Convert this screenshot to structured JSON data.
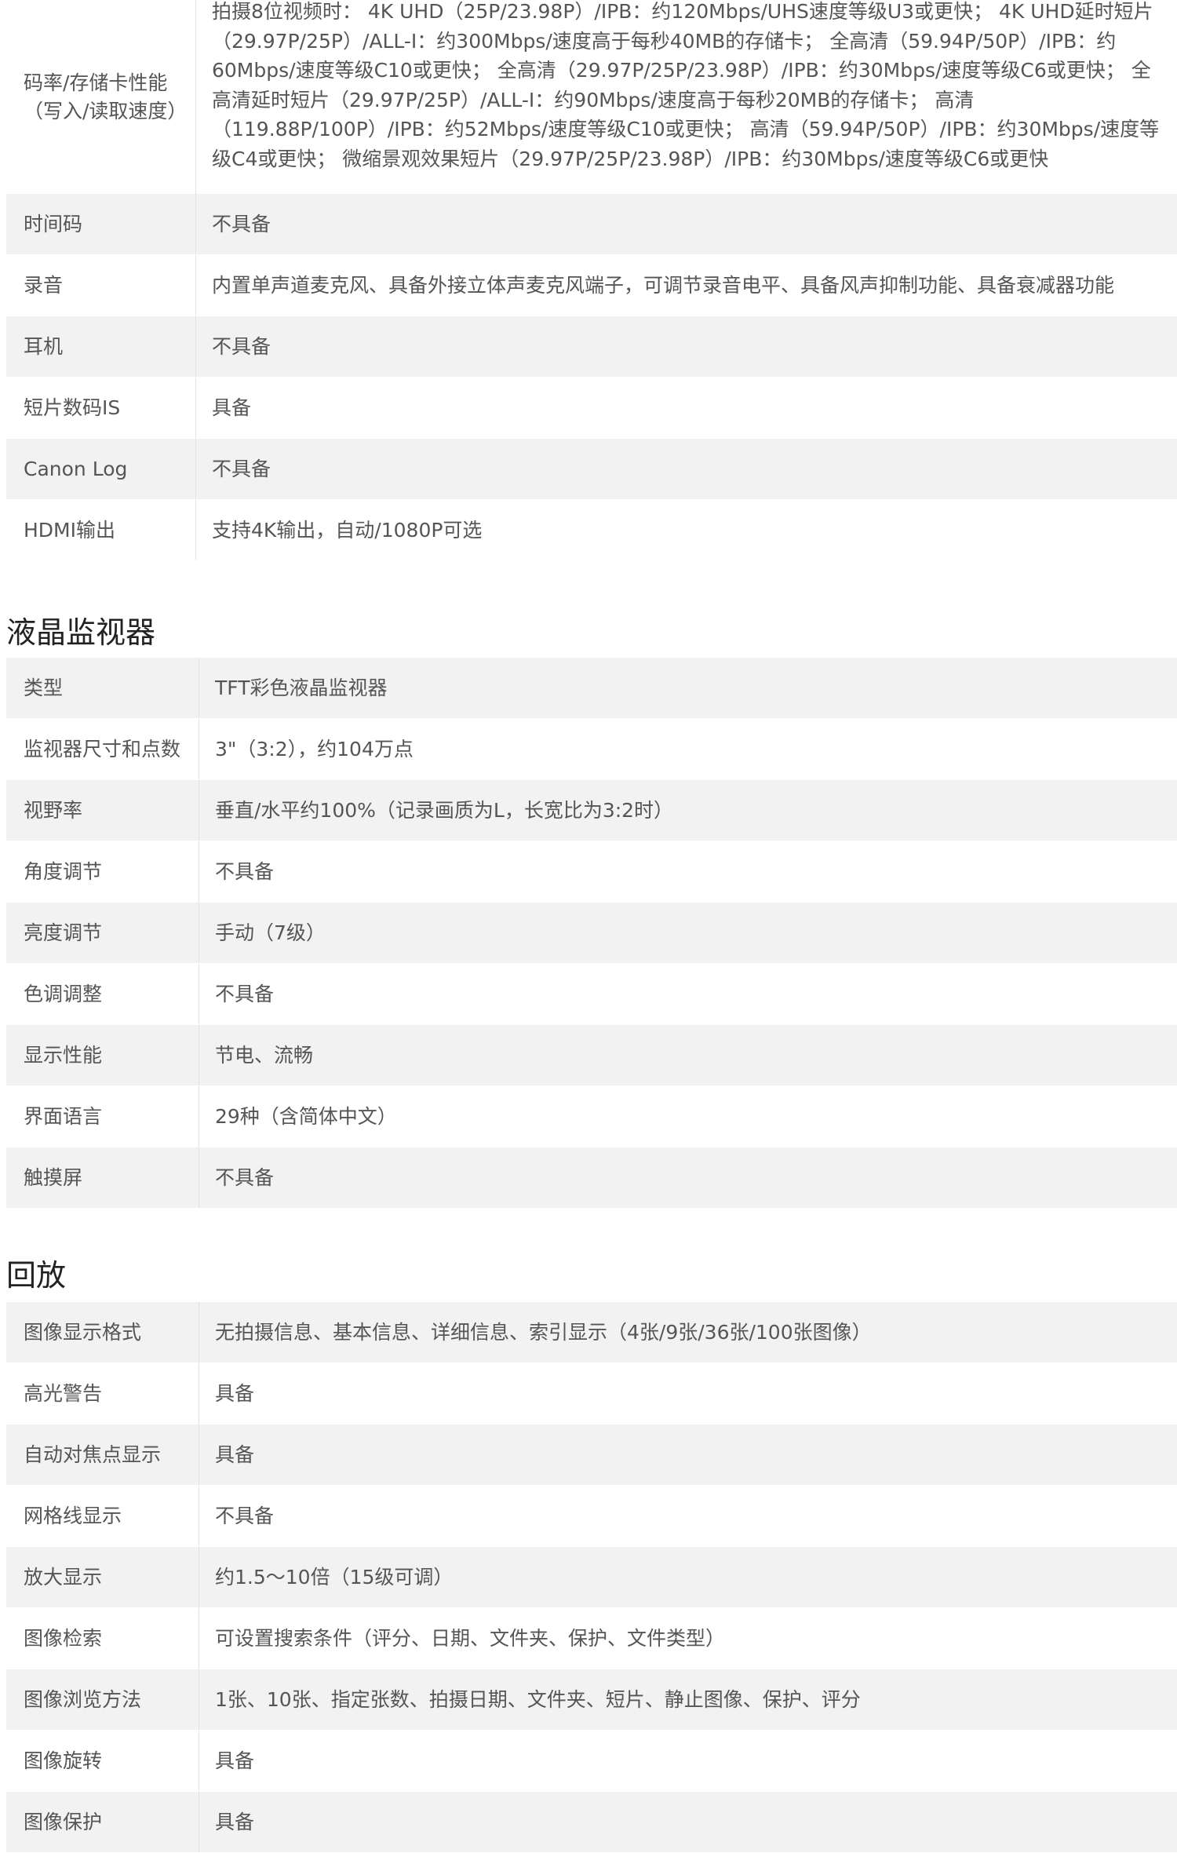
{
  "recording": {
    "rows": [
      {
        "label": "码率/存储卡性能（写入/读取速度）",
        "value": "拍摄8位视频时： 4K UHD（25P/23.98P）/IPB：约120Mbps/UHS速度等级U3或更快； 4K UHD延时短片（29.97P/25P）/ALL-I：约300Mbps/速度高于每秒40MB的存储卡； 全高清（59.94P/50P）/IPB：约60Mbps/速度等级C10或更快； 全高清（29.97P/25P/23.98P）/IPB：约30Mbps/速度等级C6或更快； 全高清延时短片（29.97P/25P）/ALL-I：约90Mbps/速度高于每秒20MB的存储卡； 高清（119.88P/100P）/IPB：约52Mbps/速度等级C10或更快； 高清（59.94P/50P）/IPB：约30Mbps/速度等级C4或更快； 微缩景观效果短片（29.97P/25P/23.98P）/IPB：约30Mbps/速度等级C6或更快"
      },
      {
        "label": "时间码",
        "value": "不具备"
      },
      {
        "label": "录音",
        "value": "内置单声道麦克风、具备外接立体声麦克风端子，可调节录音电平、具备风声抑制功能、具备衰减器功能"
      },
      {
        "label": "耳机",
        "value": "不具备"
      },
      {
        "label": "短片数码IS",
        "value": "具备"
      },
      {
        "label": "Canon Log",
        "value": "不具备"
      },
      {
        "label": "HDMI输出",
        "value": "支持4K输出，自动/1080P可选"
      }
    ]
  },
  "lcd": {
    "title": "液晶监视器",
    "rows": [
      {
        "label": "类型",
        "value": "TFT彩色液晶监视器"
      },
      {
        "label": "监视器尺寸和点数",
        "value": "3\"（3:2），约104万点"
      },
      {
        "label": "视野率",
        "value": "垂直/水平约100%（记录画质为L，长宽比为3:2时）"
      },
      {
        "label": "角度调节",
        "value": "不具备"
      },
      {
        "label": "亮度调节",
        "value": "手动（7级）"
      },
      {
        "label": "色调调整",
        "value": "不具备"
      },
      {
        "label": "显示性能",
        "value": "节电、流畅"
      },
      {
        "label": "界面语言",
        "value": "29种（含简体中文）"
      },
      {
        "label": "触摸屏",
        "value": "不具备"
      }
    ]
  },
  "playback": {
    "title": "回放",
    "rows": [
      {
        "label": "图像显示格式",
        "value": "无拍摄信息、基本信息、详细信息、索引显示（4张/9张/36张/100张图像）"
      },
      {
        "label": "高光警告",
        "value": "具备"
      },
      {
        "label": "自动对焦点显示",
        "value": "具备"
      },
      {
        "label": "网格线显示",
        "value": "不具备"
      },
      {
        "label": "放大显示",
        "value": "约1.5～10倍（15级可调）"
      },
      {
        "label": "图像检索",
        "value": "可设置搜索条件（评分、日期、文件夹、保护、文件类型）"
      },
      {
        "label": "图像浏览方法",
        "value": "1张、10张、指定张数、拍摄日期、文件夹、短片、静止图像、保护、评分"
      },
      {
        "label": "图像旋转",
        "value": "具备"
      },
      {
        "label": "图像保护",
        "value": "具备"
      }
    ]
  }
}
